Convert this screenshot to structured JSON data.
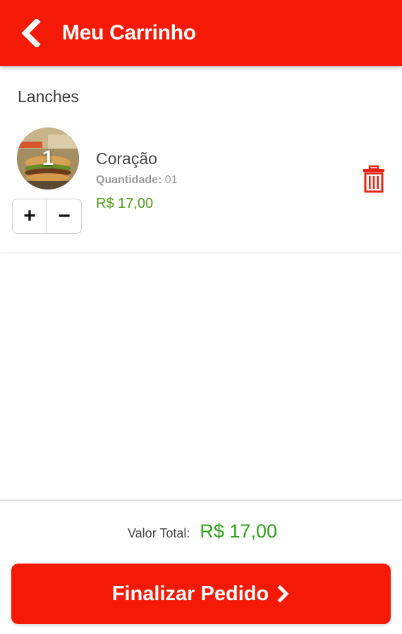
{
  "header": {
    "title": "Meu Carrinho",
    "back_icon": "chevron-left-icon",
    "background_color": "#f41a05"
  },
  "cart": {
    "section_title": "Lanches",
    "items": [
      {
        "name": "Coração",
        "quantity_label": "Quantidade:",
        "quantity_value": "01",
        "price": "R$ 17,00",
        "thumb_count": "1",
        "increment_label": "+",
        "decrement_label": "−",
        "delete_icon": "trash-icon"
      }
    ]
  },
  "footer": {
    "total_label": "Valor Total:",
    "total_value": "R$ 17,00",
    "submit_label": "Finalizar Pedido",
    "submit_icon": "chevron-right-icon"
  },
  "colors": {
    "accent": "#f41a05",
    "price_green": "#4f9e1e",
    "total_green": "#2fa11b"
  }
}
